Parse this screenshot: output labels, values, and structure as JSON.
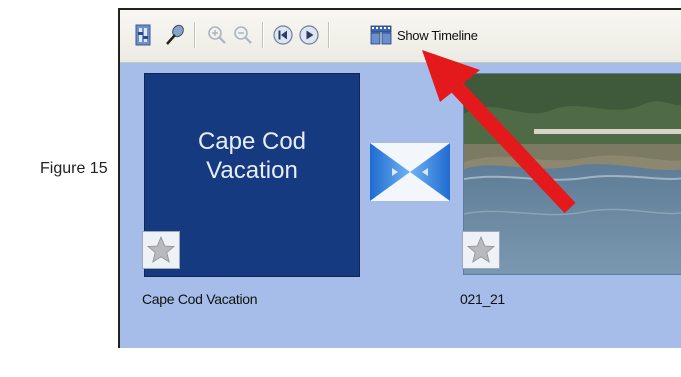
{
  "figure_caption": "Figure 15",
  "toolbar": {
    "show_timeline_label": "Show Timeline",
    "buttons": [
      {
        "name": "set-audio-levels-icon"
      },
      {
        "name": "narrate-timeline-icon"
      },
      {
        "name": "zoom-in-icon"
      },
      {
        "name": "zoom-out-icon"
      },
      {
        "name": "rewind-icon"
      },
      {
        "name": "play-icon"
      },
      {
        "name": "timeline-icon"
      }
    ]
  },
  "storyboard": {
    "clips": [
      {
        "title_text": "Cape Cod\nVacation",
        "label": "Cape Cod Vacation"
      },
      {
        "label": "021_21"
      }
    ]
  },
  "colors": {
    "storyboard_bg": "#a6bde9",
    "title_clip_bg": "#163a80",
    "arrow": "#e4191b"
  }
}
